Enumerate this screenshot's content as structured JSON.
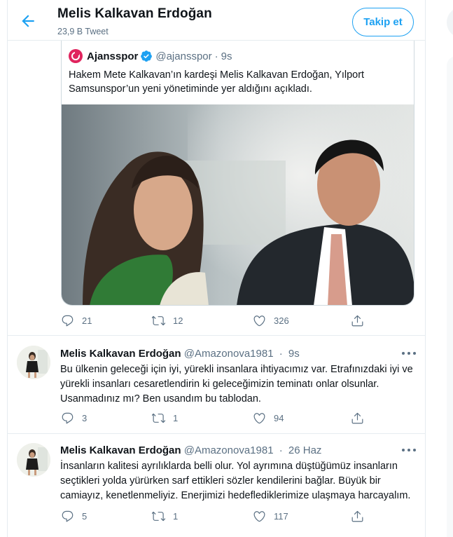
{
  "header": {
    "title": "Melis Kalkavan Erdoğan",
    "subtitle": "23,9 B Tweet",
    "follow_label": "Takip et",
    "back_icon": "arrow-left-icon"
  },
  "quoted_tweet": {
    "author": "Ajansspor",
    "handle": "@ajansspor",
    "time": "9s",
    "text": "Hakem Mete Kalkavan’ın kardeşi Melis Kalkavan Erdoğan, Yılport Samsunspor’un yeni yönetiminde yer aldığını açıkladı.",
    "verified": true,
    "logo_color": "#e0245e",
    "stats": {
      "replies": "21",
      "retweets": "12",
      "likes": "326"
    }
  },
  "tweets": [
    {
      "author": "Melis Kalkavan Erdoğan",
      "handle": "@Amazonova1981",
      "time": "9s",
      "text": "Bu ülkenin geleceği için iyi, yürekli insanlara ihtiyacımız var. Etrafınızdaki iyi ve yürekli insanları cesaretlendirin ki geleceğimizin teminatı onlar olsunlar. Usanmadınız mı? Ben usandım bu tablodan.",
      "stats": {
        "replies": "3",
        "retweets": "1",
        "likes": "94"
      }
    },
    {
      "author": "Melis Kalkavan Erdoğan",
      "handle": "@Amazonova1981",
      "time": "26 Haz",
      "text": "İnsanların kalitesi ayrılıklarda belli olur. Yol ayrımına düştüğümüz insanların seçtikleri yolda yürürken sarf ettikleri sözler kendilerini bağlar. Büyük bir camiayız, kenetlenmeliyiz. Enerjimizi hedeflediklerimize ulaşmaya harcayalım.",
      "stats": {
        "replies": "5",
        "retweets": "1",
        "likes": "117"
      }
    }
  ],
  "colors": {
    "accent": "#1da1f2",
    "muted": "#5b7083",
    "text": "#0f1419",
    "border": "#e6ecf0"
  }
}
